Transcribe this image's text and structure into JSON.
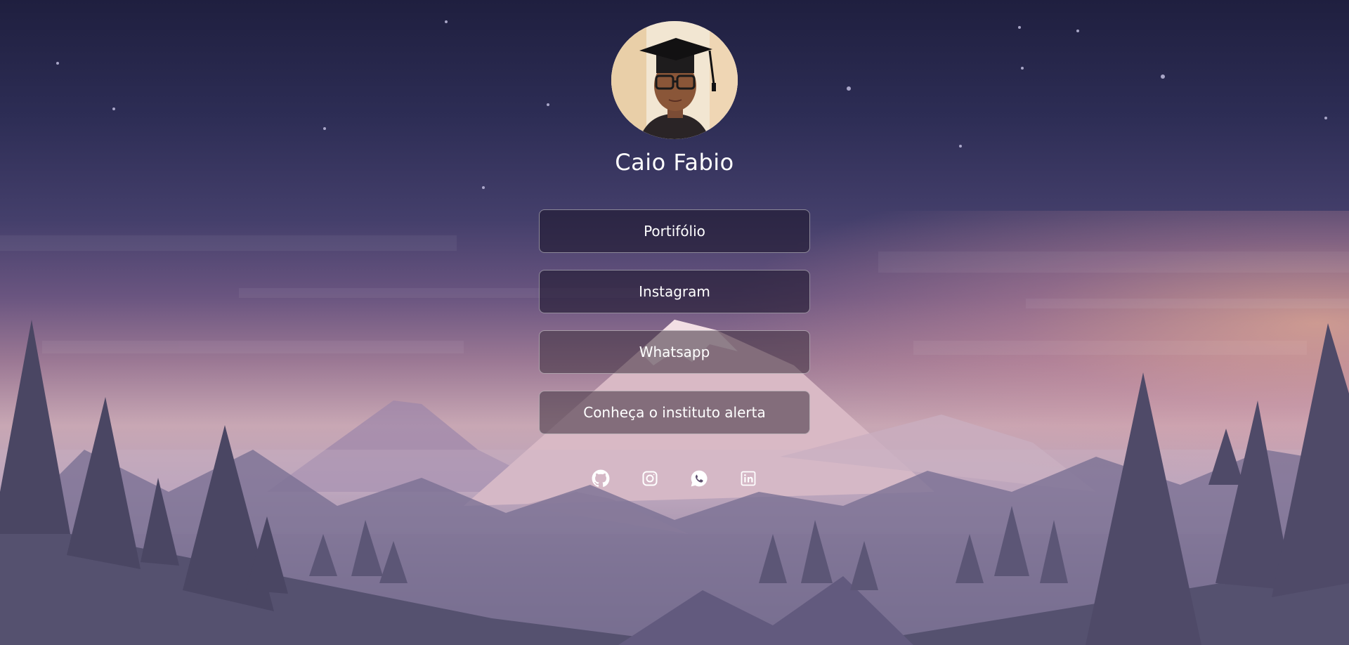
{
  "profile": {
    "name": "Caio Fabio"
  },
  "links": [
    {
      "label": "Portifólio"
    },
    {
      "label": "Instagram"
    },
    {
      "label": "Whatsapp"
    },
    {
      "label": "Conheça o instituto alerta"
    }
  ],
  "socials": [
    {
      "icon": "github-icon"
    },
    {
      "icon": "instagram-icon"
    },
    {
      "icon": "whatsapp-icon"
    },
    {
      "icon": "linkedin-icon"
    }
  ],
  "colors": {
    "sky_top": "#1f1f3f",
    "horizon_glow": "#f7b796",
    "text": "#ffffff"
  }
}
